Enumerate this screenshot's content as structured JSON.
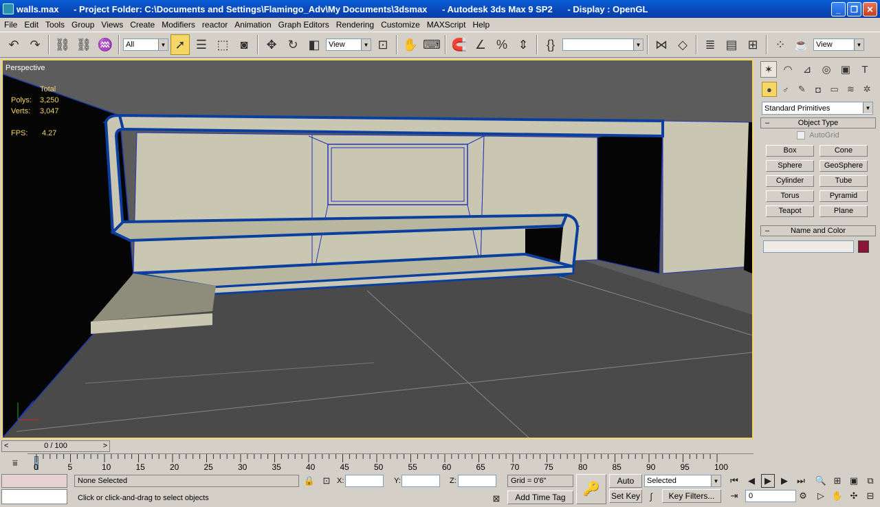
{
  "window": {
    "title": "walls.max      - Project Folder: C:\\Documents and Settings\\Flamingo_Adv\\My Documents\\3dsmax      - Autodesk 3ds Max 9 SP2      - Display : OpenGL",
    "minimize": "_",
    "maximize": "❐",
    "close": "✕"
  },
  "menu": [
    "File",
    "Edit",
    "Tools",
    "Group",
    "Views",
    "Create",
    "Modifiers",
    "reactor",
    "Animation",
    "Graph Editors",
    "Rendering",
    "Customize",
    "MAXScript",
    "Help"
  ],
  "toolbar": {
    "selection_filter": "All",
    "ref_coord": "View",
    "named_selection": "",
    "view_combo": "View"
  },
  "viewport": {
    "label": "Perspective",
    "stats": {
      "total_label": "Total",
      "polys_label": "Polys:",
      "polys_value": "3,250",
      "verts_label": "Verts:",
      "verts_value": "3,047",
      "fps_label": "FPS:",
      "fps_value": "4.27"
    }
  },
  "command_panel": {
    "category": "Standard Primitives",
    "object_type_title": "Object Type",
    "autogrid": "AutoGrid",
    "buttons": [
      "Box",
      "Cone",
      "Sphere",
      "GeoSphere",
      "Cylinder",
      "Tube",
      "Torus",
      "Pyramid",
      "Teapot",
      "Plane"
    ],
    "name_color_title": "Name and Color",
    "color": "#8a1538"
  },
  "timeline": {
    "slider": "0 / 100",
    "ticks": [
      "0",
      "5",
      "10",
      "15",
      "20",
      "25",
      "30",
      "35",
      "40",
      "45",
      "50",
      "55",
      "60",
      "65",
      "70",
      "75",
      "80",
      "85",
      "90",
      "95",
      "100"
    ]
  },
  "status": {
    "selection": "None Selected",
    "prompt": "Click or click-and-drag to select objects",
    "x_label": "X:",
    "y_label": "Y:",
    "z_label": "Z:",
    "grid": "Grid = 0'6\"",
    "add_time_tag": "Add Time Tag",
    "auto_key": "Auto Key",
    "set_key": "Set Key",
    "key_mode": "Selected",
    "key_filters": "Key Filters...",
    "frame": "0"
  }
}
